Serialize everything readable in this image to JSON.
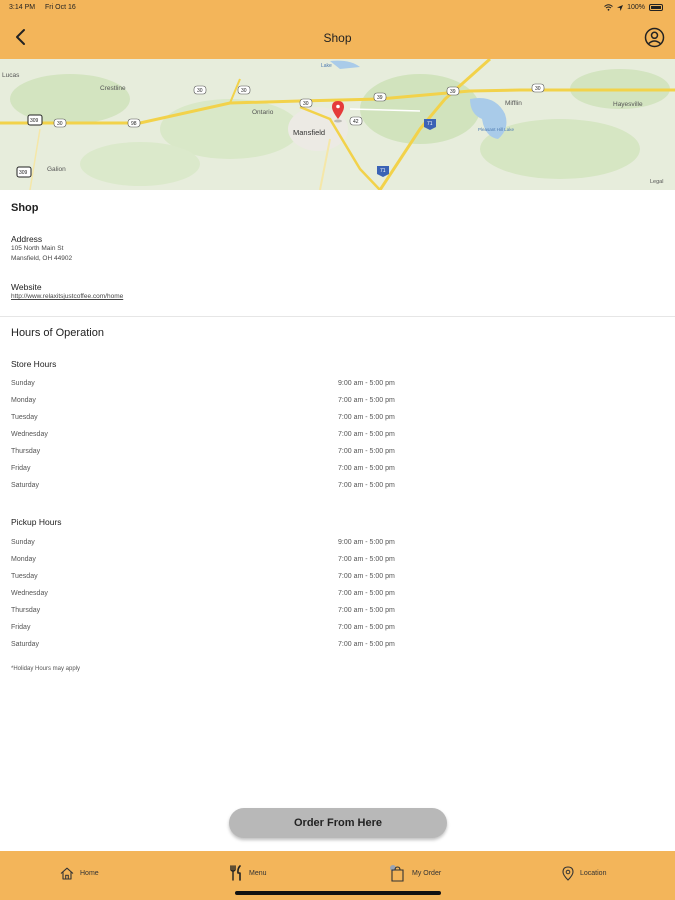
{
  "status_bar": {
    "time": "3:14 PM",
    "date": "Fri Oct 16",
    "battery": "100%"
  },
  "header": {
    "title": "Shop"
  },
  "map": {
    "labels": [
      "Lucas",
      "Crestline",
      "Ontario",
      "Mansfield",
      "Galion",
      "Mifflin",
      "Hayesville",
      "Lake",
      "Pleasant Hill Lake",
      "Legal"
    ],
    "routes": [
      "30",
      "30",
      "30",
      "30",
      "98",
      "39",
      "39",
      "42",
      "71",
      "71",
      "309",
      "309",
      "30"
    ]
  },
  "shop": {
    "name": "Shop",
    "address_label": "Address",
    "address_line1": "105 North Main St",
    "address_line2": "Mansfield, OH 44902",
    "website_label": "Website",
    "website_url": "http://www.relaxitsjustcoffee.com/home"
  },
  "hours": {
    "title": "Hours of Operation",
    "store_label": "Store Hours",
    "store": [
      {
        "day": "Sunday",
        "time": "9:00 am - 5:00 pm"
      },
      {
        "day": "Monday",
        "time": "7:00 am - 5:00 pm"
      },
      {
        "day": "Tuesday",
        "time": "7:00 am - 5:00 pm"
      },
      {
        "day": "Wednesday",
        "time": "7:00 am - 5:00 pm"
      },
      {
        "day": "Thursday",
        "time": "7:00 am - 5:00 pm"
      },
      {
        "day": "Friday",
        "time": "7:00 am - 5:00 pm"
      },
      {
        "day": "Saturday",
        "time": "7:00 am - 5:00 pm"
      }
    ],
    "pickup_label": "Pickup Hours",
    "pickup": [
      {
        "day": "Sunday",
        "time": "9:00 am - 5:00 pm"
      },
      {
        "day": "Monday",
        "time": "7:00 am - 5:00 pm"
      },
      {
        "day": "Tuesday",
        "time": "7:00 am - 5:00 pm"
      },
      {
        "day": "Wednesday",
        "time": "7:00 am - 5:00 pm"
      },
      {
        "day": "Thursday",
        "time": "7:00 am - 5:00 pm"
      },
      {
        "day": "Friday",
        "time": "7:00 am - 5:00 pm"
      },
      {
        "day": "Saturday",
        "time": "7:00 am - 5:00 pm"
      }
    ],
    "note": "*Holiday Hours may apply"
  },
  "order_button": "Order From Here",
  "tabs": {
    "home": "Home",
    "menu": "Menu",
    "my_order": "My Order",
    "location": "Location"
  },
  "colors": {
    "brand": "#f3b55a",
    "button": "#b8b8b8"
  },
  "icons": [
    "back-icon",
    "profile-icon",
    "map-pin-icon",
    "home-icon",
    "utensils-icon",
    "bag-icon",
    "location-pin-icon"
  ]
}
